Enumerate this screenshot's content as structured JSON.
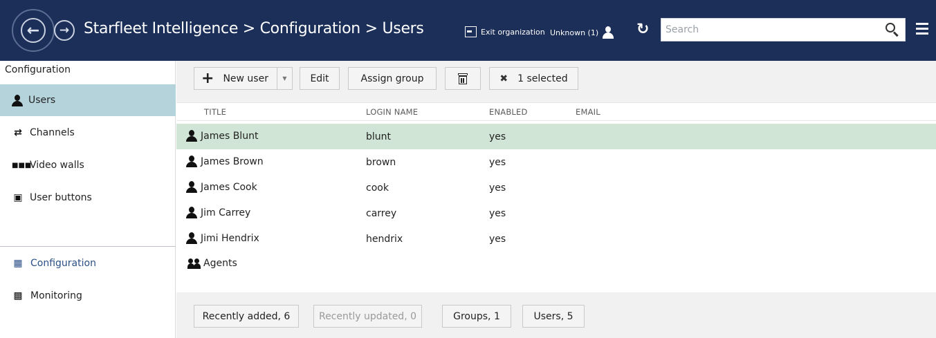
{
  "header": {
    "breadcrumb": [
      "Starfleet Intelligence",
      "Configuration",
      "Users"
    ],
    "separator": ">",
    "exit_label": "Exit organization",
    "user_label": "Unknown (1)",
    "search_placeholder": "Search",
    "background": "#1c2f59"
  },
  "sidebar": {
    "title": "Configuration",
    "items": [
      {
        "label": "Users",
        "icon": "user-icon",
        "active": true
      },
      {
        "label": "Channels",
        "icon": "shuffle-icon"
      },
      {
        "label": "Video walls",
        "icon": "grid-icon"
      },
      {
        "label": "User buttons",
        "icon": "user-buttons-icon"
      }
    ],
    "bottom_items": [
      {
        "label": "Configuration",
        "icon": "configuration-icon",
        "active": true
      },
      {
        "label": "Monitoring",
        "icon": "monitoring-icon"
      }
    ],
    "active_color": "#b5d3db"
  },
  "toolbar": {
    "new_user": "New user",
    "edit": "Edit",
    "assign_group": "Assign group",
    "selected": "1 selected"
  },
  "table": {
    "columns": [
      "TITLE",
      "LOGIN NAME",
      "ENABLED",
      "EMAIL"
    ],
    "rows": [
      {
        "title": "James Blunt",
        "login": "blunt",
        "enabled": "yes",
        "selected": true
      },
      {
        "title": "James Brown",
        "login": "brown",
        "enabled": "yes"
      },
      {
        "title": "James Cook",
        "login": "cook",
        "enabled": "yes"
      },
      {
        "title": "Jim Carrey",
        "login": "carrey",
        "enabled": "yes"
      },
      {
        "title": "Jimi Hendrix",
        "login": "hendrix",
        "enabled": "yes"
      },
      {
        "title": "Agents",
        "login": "",
        "enabled": "",
        "group": true
      }
    ],
    "selected_color": "#d0e5d6"
  },
  "footer": {
    "recently_added": "Recently added, 6",
    "recently_updated": "Recently updated, 0",
    "groups": "Groups, 1",
    "users": "Users, 5"
  }
}
